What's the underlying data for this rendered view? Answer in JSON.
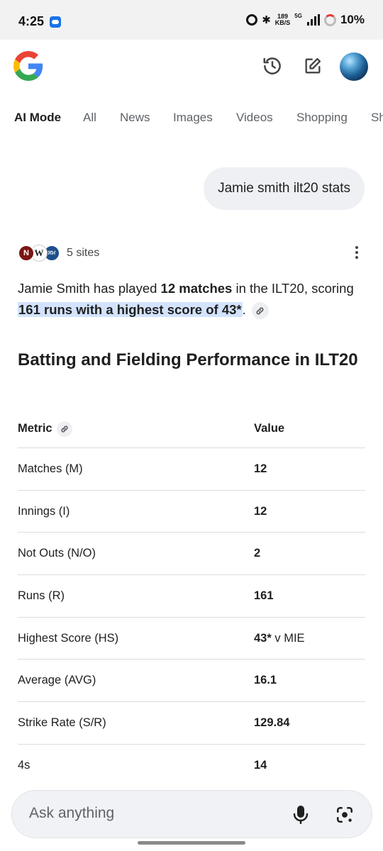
{
  "status": {
    "time": "4:25",
    "speed_value": "189",
    "speed_unit": "KB/S",
    "network": "5G",
    "battery": "10%"
  },
  "tabs": [
    {
      "label": "AI Mode",
      "active": true
    },
    {
      "label": "All"
    },
    {
      "label": "News"
    },
    {
      "label": "Images"
    },
    {
      "label": "Videos"
    },
    {
      "label": "Shopping"
    },
    {
      "label": "Sh"
    }
  ],
  "query": "Jamie smith ilt20 stats",
  "sources": {
    "logos": [
      "N",
      "W",
      "ਸਮ"
    ],
    "count_label": "5 sites"
  },
  "answer": {
    "p1": "Jamie Smith has played ",
    "b1": "12 matches",
    "p2": " in the ILT20, scoring ",
    "highlight": "161 runs with a highest score of 43*",
    "p3": "."
  },
  "section_title": "Batting and Fielding Performance in ILT20",
  "table": {
    "headers": [
      "Metric",
      "Value"
    ],
    "rows": [
      {
        "metric": "Matches (M)",
        "value": "12",
        "bold": "12",
        "rest": ""
      },
      {
        "metric": "Innings (I)",
        "value": "12",
        "bold": "12",
        "rest": ""
      },
      {
        "metric": "Not Outs (N/O)",
        "value": "2",
        "bold": "2",
        "rest": ""
      },
      {
        "metric": "Runs (R)",
        "value": "161",
        "bold": "161",
        "rest": ""
      },
      {
        "metric": "Highest Score (HS)",
        "value": "43* v MIE",
        "bold": "43*",
        "rest": " v MIE"
      },
      {
        "metric": "Average (AVG)",
        "value": "16.1",
        "bold": "16.1",
        "rest": ""
      },
      {
        "metric": "Strike Rate (S/R)",
        "value": "129.84",
        "bold": "129.84",
        "rest": ""
      },
      {
        "metric": "4s",
        "value": "14",
        "bold": "14",
        "rest": ""
      }
    ]
  },
  "input": {
    "placeholder": "Ask anything"
  },
  "colors": {
    "highlight": "#d3e3fd",
    "bubble": "#eef0f4",
    "google_blue": "#4285F4",
    "google_red": "#EA4335",
    "google_yellow": "#FBBC05",
    "google_green": "#34A853"
  }
}
